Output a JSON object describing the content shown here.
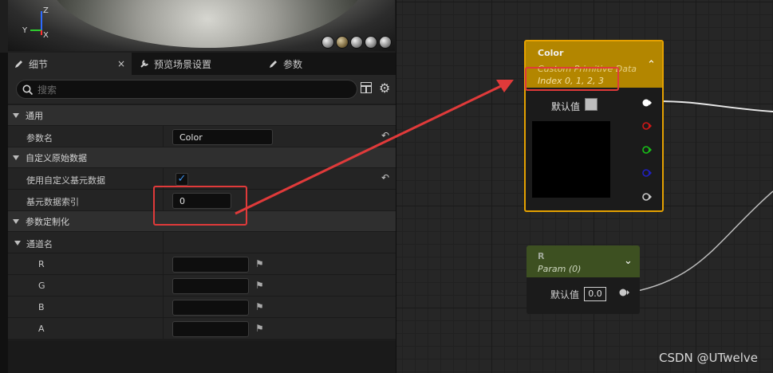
{
  "preview": {
    "axis_labels": {
      "z": "Z",
      "y": "Y",
      "x": "X"
    },
    "shape_icons": [
      "cylinder-icon",
      "sphere-icon",
      "plane-icon",
      "cube-icon",
      "teapot-icon"
    ]
  },
  "tabs": [
    {
      "label": "细节",
      "close": "×",
      "icon": "pencil-icon"
    },
    {
      "label": "预览场景设置",
      "icon": "wrench-icon"
    },
    {
      "label": "参数",
      "icon": "pencil-icon"
    }
  ],
  "search": {
    "placeholder": "搜索"
  },
  "details": {
    "cat_general": "通用",
    "param_name_label": "参数名",
    "param_name_value": "Color",
    "cat_custom_primitive": "自定义原始数据",
    "use_custom_label": "使用自定义基元数据",
    "use_custom_checked": true,
    "index_label": "基元数据索引",
    "index_value": "0",
    "cat_param_customization": "参数定制化",
    "channel_names_label": "通道名",
    "channels": [
      "R",
      "G",
      "B",
      "A"
    ],
    "reset_glyph": "↶",
    "check_glyph": "✓"
  },
  "node_color": {
    "title": "Color",
    "subtitle": "Custom Primitive Data",
    "index_line": "Index 0, 1, 2, 3",
    "collapse_glyph": "⌃",
    "default_label": "默认值",
    "pin_colors": [
      "#ffffff",
      "#d01818",
      "#18c018",
      "#2020c0",
      "#c8c8c8"
    ]
  },
  "node_param": {
    "title": "R",
    "subtitle": "Param (0)",
    "expand_glyph": "⌄",
    "default_label": "默认值",
    "default_value": "0.0"
  },
  "watermark": "CSDN @UTwelve",
  "colors": {
    "node_border": "#e5a100",
    "node_header": "#b38600",
    "annotation": "#e03a3a",
    "param_header": "#3d5021"
  }
}
